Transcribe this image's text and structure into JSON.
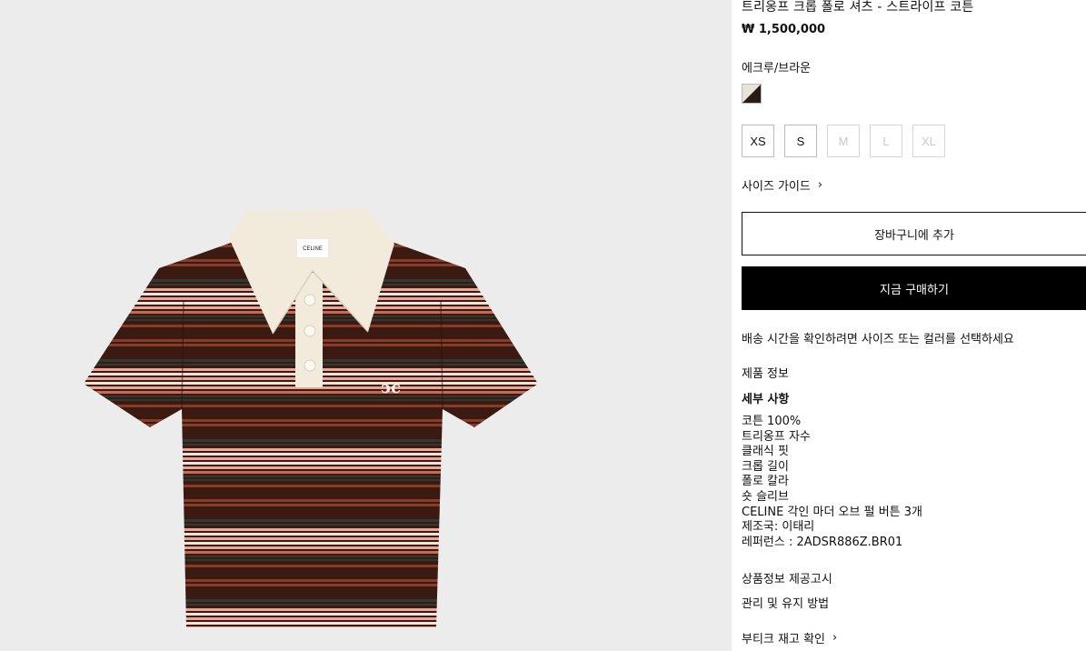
{
  "product": {
    "title": "트리옹프 크롭 폴로 셔츠 - 스트라이프 코튼",
    "price": "₩ 1,500,000",
    "color_name": "에크루/브라운",
    "image_label": "CELINE"
  },
  "sizes": [
    {
      "label": "XS",
      "available": true
    },
    {
      "label": "S",
      "available": true
    },
    {
      "label": "M",
      "available": false
    },
    {
      "label": "L",
      "available": false
    },
    {
      "label": "XL",
      "available": false
    }
  ],
  "size_guide": {
    "label": "사이즈 가이드",
    "icon": "chevron-right-icon"
  },
  "actions": {
    "add_to_cart": "장바구니에 추가",
    "buy_now": "지금 구매하기"
  },
  "shipping_note": "배송 시간을 확인하려면 사이즈 또는 컬러를 선택하세요",
  "info": {
    "product_info": "제품 정보",
    "details_heading": "세부 사항",
    "details": [
      "코튼 100%",
      "트리옹프 자수",
      "클래식 핏",
      "크롭 길이",
      "폴로 칼라",
      "숏 슬리브",
      "CELINE 각인 마더 오브 펄 버튼 3개",
      "제조국: 이태리",
      "레퍼런스 : 2ADSR886Z.BR01"
    ],
    "notice": "상품정보 제공고시",
    "care": "관리 및 유지 방법",
    "boutique": "부티크 재고 확인"
  },
  "colors": {
    "image_bg": "#ececec",
    "stripe_brown": "#3b1a12",
    "stripe_rust": "#8a3a28",
    "stripe_pink": "#e9a79a",
    "stripe_cream": "#f1e3d7",
    "stripe_green": "#2e3a33",
    "collar": "#f2ebdc",
    "buy_button": "#000000"
  }
}
